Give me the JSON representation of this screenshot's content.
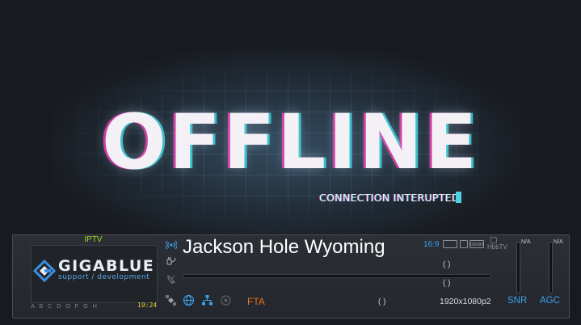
{
  "video": {
    "title": "OFFLINE",
    "subtitle": "CONNECTION INTERUPTED"
  },
  "infobar": {
    "provider": "IPTV",
    "logo": {
      "brand": "GIGABLUE",
      "tagline": "support / development"
    },
    "ca_systems": "A B C D O F G H",
    "clock": "19:24",
    "channel_name": "Jackson Hole Wyoming",
    "aspect_ratio": "16:9",
    "flags": {
      "dolby": "DOLBY",
      "hbbtv": "HbbTV"
    },
    "now_bracket": "(            )",
    "next_bracket": "(            )",
    "tuner_bracket": "(            )",
    "encryption": "FTA",
    "resolution": "1920x1080p2",
    "snr": {
      "label": "SNR",
      "value": "N/A"
    },
    "agc": {
      "label": "AGC",
      "value": "N/A"
    }
  },
  "colors": {
    "accent_blue": "#3aa2ec",
    "provider_green": "#9be11e",
    "fta_orange": "#e7731e",
    "clock_yellow": "#e4d230",
    "glitch_cyan": "#4fd1e6",
    "glitch_magenta": "#ff3cbe"
  },
  "icons": {
    "radio": "radio-waves-icon",
    "plug": "plug-icon",
    "satellite_dish": "satellite-dish-icon",
    "satellite": "satellite-icon",
    "globe": "globe-icon",
    "network": "network-icon",
    "stream": "stream-icon"
  }
}
